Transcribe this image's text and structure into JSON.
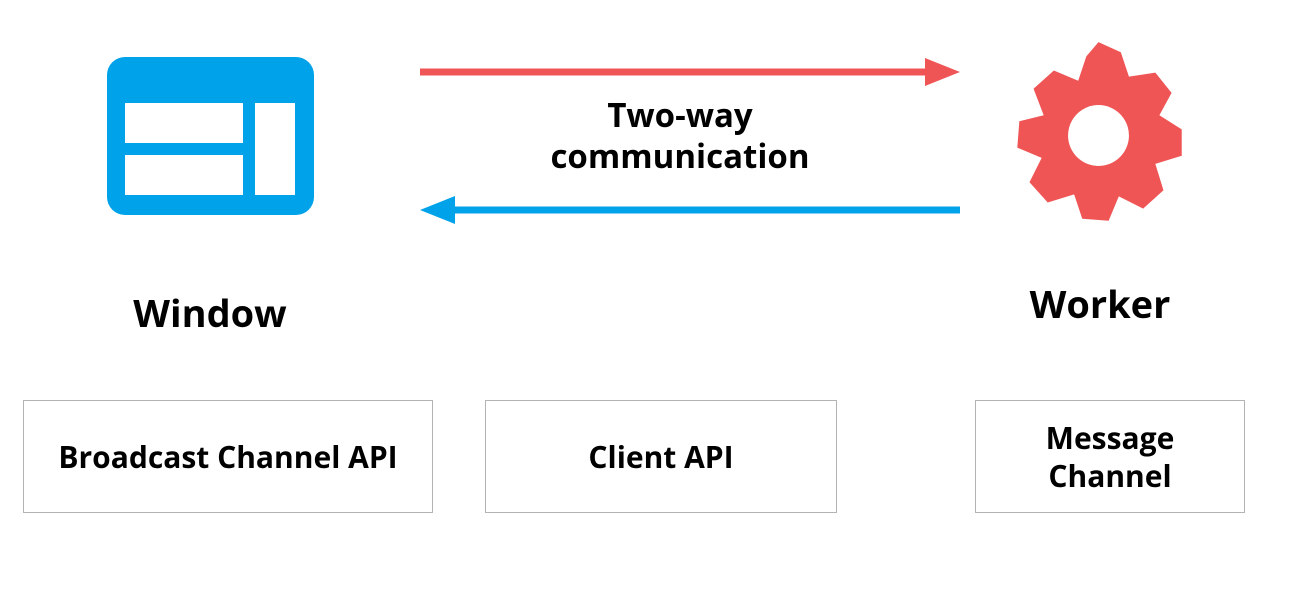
{
  "colors": {
    "window_blue": "#00a2e9",
    "arrow_red": "#f05555",
    "arrow_blue": "#00a2e9",
    "gear_red": "#f05555"
  },
  "center": {
    "line1": "Two-way",
    "line2": "communication"
  },
  "left_label": "Window",
  "right_label": "Worker",
  "api_boxes": {
    "broadcast": "Broadcast Channel API",
    "client": "Client API",
    "message": "Message Channel"
  }
}
